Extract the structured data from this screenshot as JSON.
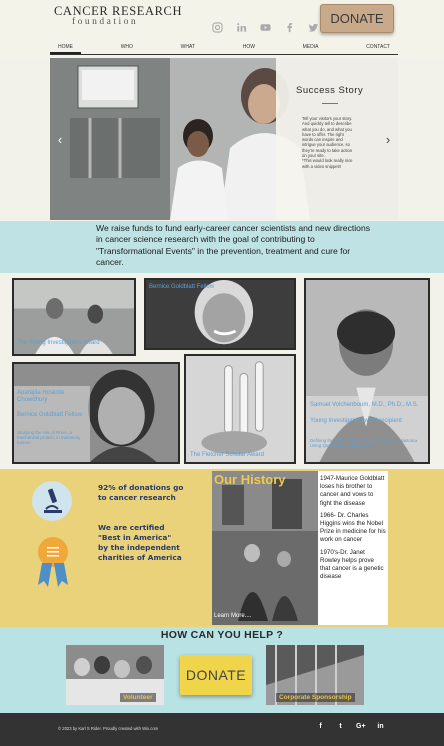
{
  "header": {
    "logo_line1": "CANCER RESEARCH",
    "logo_line2": "foundation",
    "donate_label": "DONATE",
    "social_icons": [
      "instagram-icon",
      "linkedin-icon",
      "youtube-icon",
      "facebook-icon",
      "twitter-icon"
    ]
  },
  "nav": {
    "items": [
      {
        "label": "HOME"
      },
      {
        "label": "WHO"
      },
      {
        "label": "WHAT"
      },
      {
        "label": "HOW"
      },
      {
        "label": "MEDIA"
      },
      {
        "label": "CONTACT"
      }
    ]
  },
  "hero": {
    "title": "Success Story",
    "text": "Tell your visitors your story.\nAnd quickly tell to describe\nwhat you do, and what you\nhave to offer. The right\nwords can inspire and\nintrigue your audience, so\nthey're ready to take action\non your site.\n*This would look really nice\nwith a video snippet!!"
  },
  "mission": {
    "text": "We raise funds to fund early-career cancer scientists and new directions in cancer science research with the goal of contributing to \"Transformational Events\" in the prevention, treatment and cure for cancer."
  },
  "grants": {
    "young_investigators": "The Young Investigators Award",
    "goldblatt_fellow": "Bernice Goldblatt Fellow",
    "chowdhury_name": "Aparajita Hoskote Chowdhury",
    "chowdhury_title": "Bernice Goldblatt Fellow",
    "chowdhury_desc": "Studying the role of RhoA, a mechanical protein, in mammary tumors",
    "fletcher": "The Fletcher Scholar Award",
    "volchenboum_name": "Samuel Volchenboum, M.D., Ph.D., M.S.",
    "volchenboum_title": "Young Investigator award recipient",
    "volchenboum_desc": "Defining the Role of MYCN in High-risk Neuroblastoma Using Quantitative Proteomics"
  },
  "stats": {
    "donations": "92% of donations go\nto cancer research",
    "certified": "We are certified\n\"Best in America\"\nby the independent\ncharities of America"
  },
  "history": {
    "title": "Our History",
    "learn_more": "Learn More....",
    "events": [
      "1947-Maurice Goldblatt loses his brother to cancer and vows to fight the disease",
      "1966- Dr. Charles Higgins wins the Nobel Prize in medicine for his work on cancer",
      "1970's-Dr. Janet Rowley helps prove that cancer is a genetic disease"
    ]
  },
  "help": {
    "title": "HOW CAN YOU HELP ?",
    "volunteer": "Volunteer",
    "donate": "DONATE",
    "sponsorship": "Corporate Sponsorship"
  },
  "footer": {
    "copyright": "© 2023 by Karl S Rider. Proudly created with Wix.com",
    "social_icons": [
      {
        "name": "facebook-icon",
        "glyph": "f"
      },
      {
        "name": "twitter-icon",
        "glyph": "t"
      },
      {
        "name": "googleplus-icon",
        "glyph": "G+"
      },
      {
        "name": "linkedin-icon",
        "glyph": "in"
      }
    ]
  },
  "colors": {
    "mission_bg": "#bfe3e5",
    "stats_bg": "#ead27a",
    "history_title": "#f1c94a",
    "caption_blue": "#5aa0d8",
    "donate_yellow": "#f0d54a",
    "footer_bg": "#333333"
  }
}
